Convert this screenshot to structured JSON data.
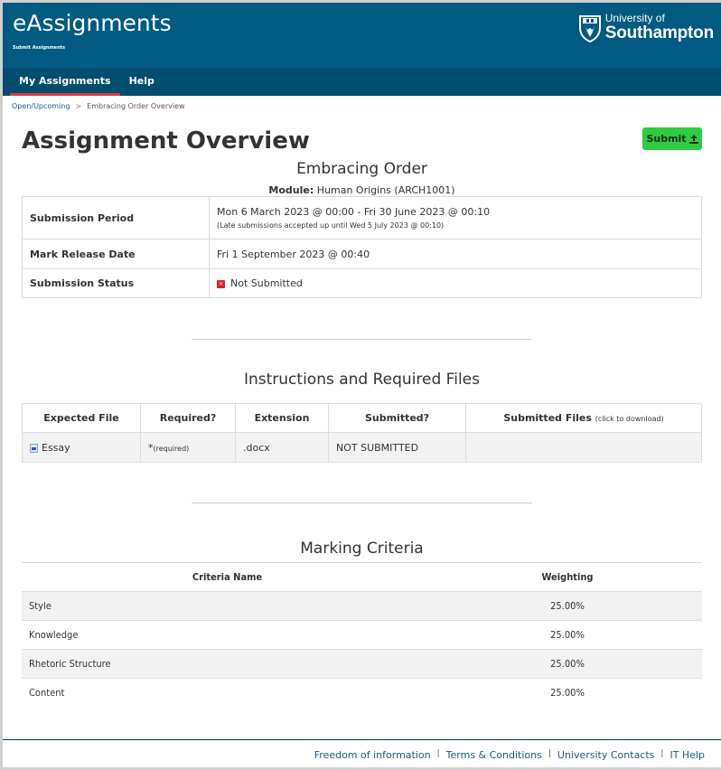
{
  "header": {
    "app_title": "eAssignments",
    "app_subtitle": "Submit Assignments",
    "logo_line1": "University of",
    "logo_line2": "Southampton",
    "brand_color": "#005a82"
  },
  "nav": {
    "items": [
      {
        "label": "My Assignments",
        "active": true
      },
      {
        "label": "Help",
        "active": false
      }
    ]
  },
  "breadcrumb": {
    "parent": "Open/Upcoming",
    "separator": ">",
    "current": "Embracing Order Overview"
  },
  "page": {
    "title": "Assignment Overview",
    "submit_label": "Submit",
    "assignment_name": "Embracing Order",
    "module_label": "Module:",
    "module_value": "Human Origins (ARCH1001)"
  },
  "info": {
    "submission_period_label": "Submission Period",
    "submission_period_value": "Mon 6 March 2023 @ 00:00 - Fri 30 June 2023 @ 00:10",
    "late_note": "(Late submissions accepted up until Wed 5 July 2023 @ 00:10)",
    "mark_release_label": "Mark Release Date",
    "mark_release_value": "Fri 1 September 2023 @ 00:40",
    "status_label": "Submission Status",
    "status_value": "Not Submitted",
    "status_color": "#e0202a"
  },
  "files": {
    "section_title": "Instructions and Required Files",
    "headers": {
      "expected_file": "Expected File",
      "required": "Required?",
      "extension": "Extension",
      "submitted": "Submitted?",
      "submitted_files": "Submitted Files",
      "submitted_files_note": "(click to download)"
    },
    "rows": [
      {
        "file": "Essay",
        "required_mark": "*",
        "required_note": "(required)",
        "extension": ".docx",
        "submitted": "NOT SUBMITTED",
        "submitted_files": ""
      }
    ]
  },
  "criteria": {
    "section_title": "Marking Criteria",
    "headers": {
      "name": "Criteria Name",
      "weighting": "Weighting"
    },
    "rows": [
      {
        "name": "Style",
        "weighting": "25.00%"
      },
      {
        "name": "Knowledge",
        "weighting": "25.00%"
      },
      {
        "name": "Rhetoric Structure",
        "weighting": "25.00%"
      },
      {
        "name": "Content",
        "weighting": "25.00%"
      }
    ]
  },
  "footer": {
    "links": [
      "Freedom of information",
      "Terms & Conditions",
      "University Contacts",
      "IT Help"
    ]
  }
}
